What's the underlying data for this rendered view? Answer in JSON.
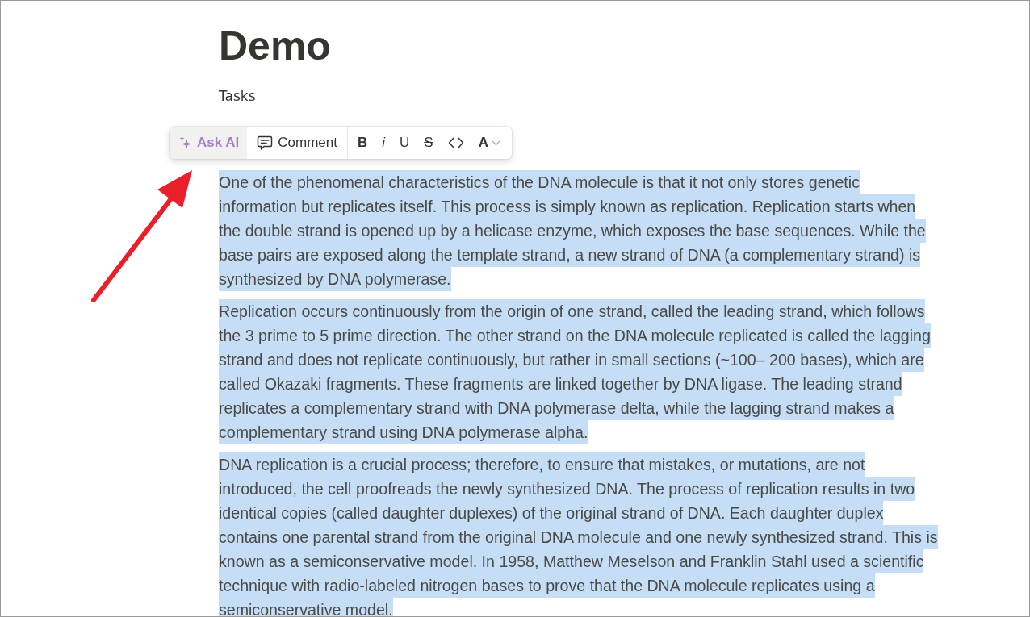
{
  "page": {
    "title": "Demo",
    "parent_link": "Tasks",
    "paragraphs": [
      {
        "text": "One of the phenomenal characteristics of the DNA molecule is that it not only stores genetic information but replicates itself. This process is simply known as replication. Replication starts when the double strand is opened up by a helicase enzyme, which exposes the base sequences. While the base pairs are exposed along the template strand, a new strand of DNA (a complementary strand) is synthesized by DNA polymerase.",
        "selected": true
      },
      {
        "text": "Replication occurs continuously from the origin of one strand, called the leading strand, which follows the 3 prime to 5 prime direction. The other strand on the DNA molecule replicated is called the lagging strand and does not replicate continuously, but rather in small sections (~100– 200 bases), which are called Okazaki fragments. These fragments are linked together by DNA ligase. The leading strand replicates a complementary strand with DNA polymerase delta, while the lagging strand makes a complementary strand using DNA polymerase alpha.",
        "selected": true
      },
      {
        "text": "DNA replication is a crucial process; therefore, to ensure that mistakes, or mutations, are not introduced, the cell proofreads the newly synthesized DNA. The process of replication results in two identical copies (called daughter duplexes) of the original strand of DNA. Each daughter duplex contains one parental strand from the original DNA molecule and one newly synthesized strand. This is known as a semiconservative model. In 1958, Matthew Meselson and Franklin Stahl used a scientific technique with radio-labeled nitrogen bases to prove that the DNA molecule replicates using a semiconservative model.",
        "selected": true
      }
    ]
  },
  "toolbar": {
    "ask_ai": "Ask AI",
    "comment": "Comment",
    "format_buttons": [
      {
        "kind": "bold",
        "label": "B"
      },
      {
        "kind": "italic",
        "label": "i"
      },
      {
        "kind": "underline",
        "label": "U"
      },
      {
        "kind": "strike",
        "label": "S"
      },
      {
        "kind": "code"
      },
      {
        "kind": "color",
        "label": "A"
      }
    ]
  }
}
